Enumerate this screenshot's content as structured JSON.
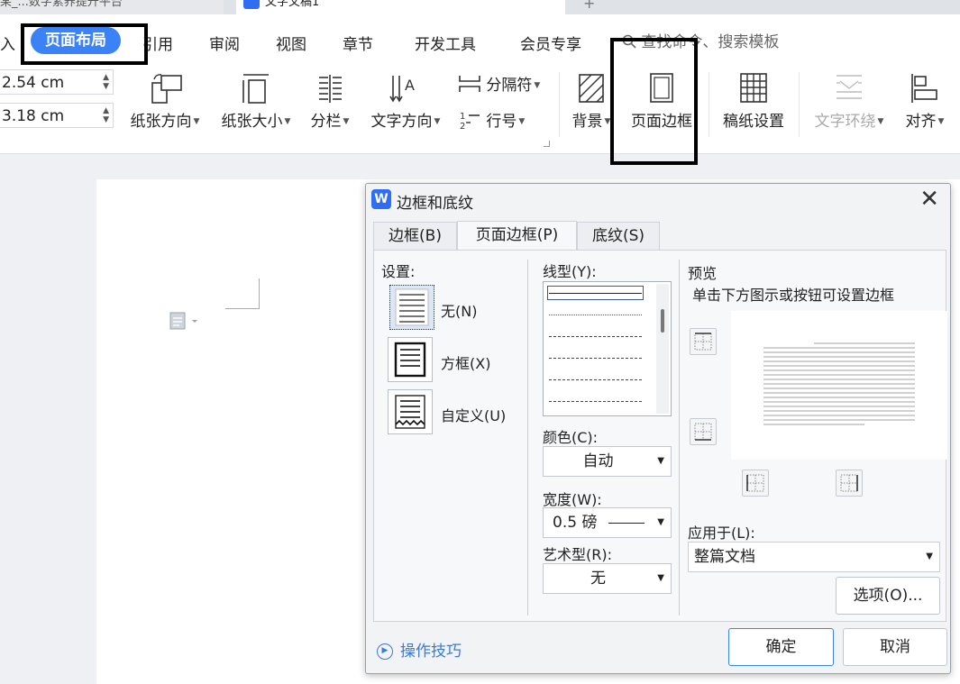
{
  "tabs": {
    "tab1_label": "某_...数字素养提升平台",
    "tab2_label": "文字文稿1",
    "new_tab": "+"
  },
  "menubar": {
    "cut_left": "入",
    "active": "页面布局",
    "items": [
      "引用",
      "审阅",
      "视图",
      "章节",
      "开发工具",
      "会员专享"
    ],
    "search_placeholder": "查找命令、搜索模板"
  },
  "ribbon": {
    "margin_top": "2.54 cm",
    "margin_left": "3.18 cm",
    "orientation": "纸张方向",
    "size": "纸张大小",
    "columns": "分栏",
    "text_direction": "文字方向",
    "breaks": "分隔符",
    "line_numbers": "行号",
    "background": "背景",
    "page_border": "页面边框",
    "manuscript": "稿纸设置",
    "text_wrap": "文字环绕",
    "align": "对齐"
  },
  "dialog": {
    "title": "边框和底纹",
    "close": "✕",
    "tabs": [
      "边框(B)",
      "页面边框(P)",
      "底纹(S)"
    ],
    "settings_label": "设置:",
    "settings": [
      "无(N)",
      "方框(X)",
      "自定义(U)"
    ],
    "line_style_label": "线型(Y):",
    "color_label": "颜色(C):",
    "color_value": "自动",
    "width_label": "宽度(W):",
    "width_value": "0.5  磅",
    "art_label": "艺术型(R):",
    "art_value": "无",
    "preview_label": "预览",
    "preview_hint": "单击下方图示或按钮可设置边框",
    "apply_label": "应用于(L):",
    "apply_value": "整篇文档",
    "options_button": "选项(O)...",
    "tips": "操作技巧",
    "ok": "确定",
    "cancel": "取消"
  }
}
